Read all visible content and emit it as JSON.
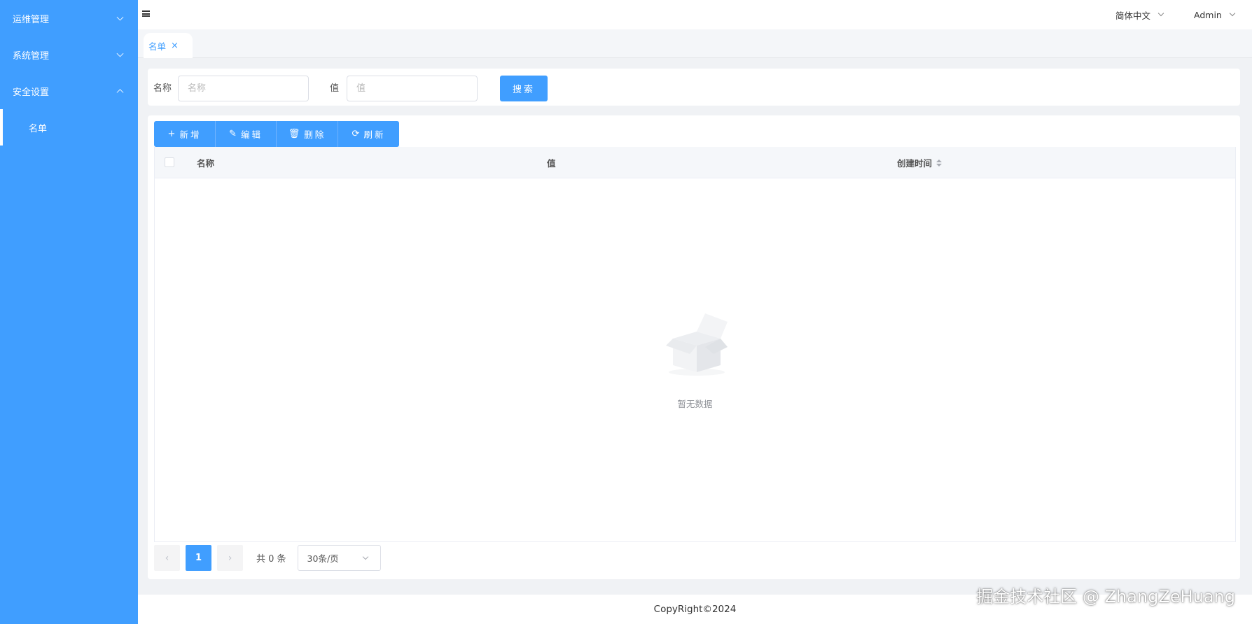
{
  "sidebar": {
    "menus": [
      {
        "label": "运维管理",
        "expanded": false
      },
      {
        "label": "系统管理",
        "expanded": false
      },
      {
        "label": "安全设置",
        "expanded": true
      }
    ],
    "submenu": [
      {
        "label": "名单",
        "active": true
      }
    ]
  },
  "header": {
    "language": "简体中文",
    "user": "Admin"
  },
  "tabs": [
    {
      "label": "名单",
      "close": "×"
    }
  ],
  "search": {
    "name_label": "名称",
    "name_placeholder": "名称",
    "name_value": "",
    "value_label": "值",
    "value_placeholder": "值",
    "value_value": "",
    "button": "搜索"
  },
  "toolbar": {
    "add": {
      "icon": "plus-icon",
      "label": "新增"
    },
    "edit": {
      "icon": "edit-icon",
      "label": "编辑"
    },
    "delete": {
      "icon": "trash-icon",
      "label": "删除"
    },
    "refresh": {
      "icon": "refresh-icon",
      "label": "刷新"
    }
  },
  "table": {
    "columns": [
      "名称",
      "值",
      "创建时间"
    ],
    "rows": [],
    "empty_text": "暂无数据"
  },
  "pagination": {
    "current_page": "1",
    "total": "共 0 条",
    "page_size": "30条/页"
  },
  "footer": "CopyRight©2024",
  "watermark": "掘金技术社区 @ ZhangZeHuang",
  "colors": {
    "primary": "#409eff",
    "background": "#f0f2f5"
  }
}
